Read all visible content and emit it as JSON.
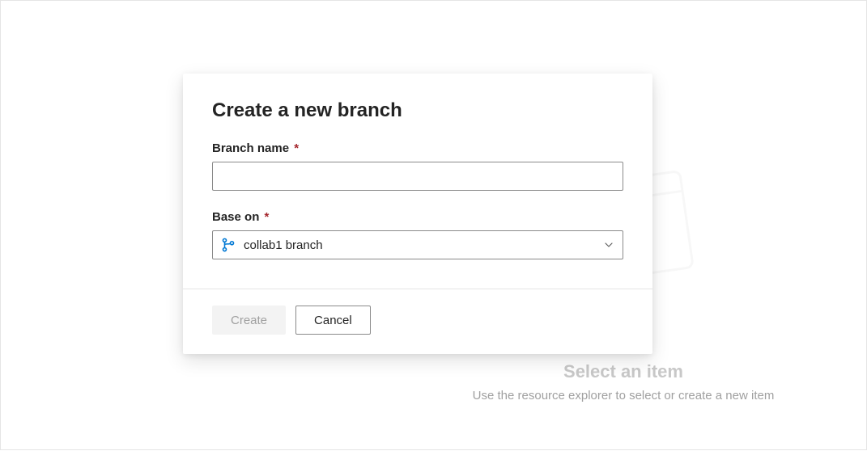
{
  "background": {
    "heading": "Select an item",
    "subtext": "Use the resource explorer to select or create a new item"
  },
  "dialog": {
    "title": "Create a new branch",
    "fields": {
      "branch_name": {
        "label": "Branch name",
        "required_marker": "*",
        "value": ""
      },
      "base_on": {
        "label": "Base on",
        "required_marker": "*",
        "selected_value": "collab1 branch",
        "icon": "branch-icon"
      }
    },
    "buttons": {
      "create": "Create",
      "cancel": "Cancel"
    }
  }
}
